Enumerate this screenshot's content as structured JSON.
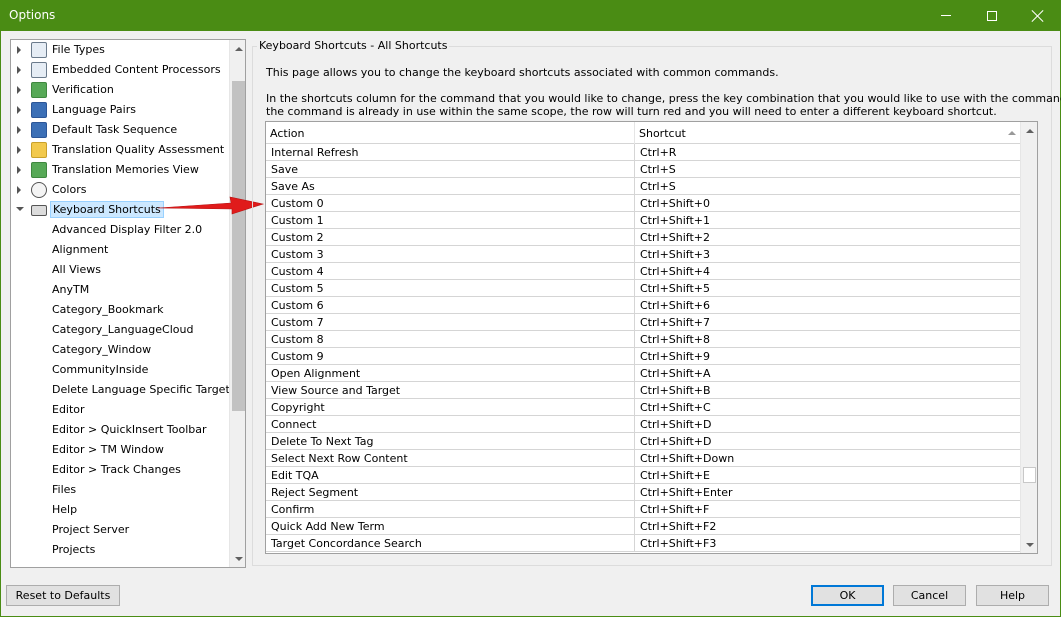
{
  "window": {
    "title": "Options"
  },
  "tree": {
    "top_items": [
      {
        "label": "File Types",
        "icon": "file-types-icon"
      },
      {
        "label": "Embedded Content Processors",
        "icon": "embedded-content-icon"
      },
      {
        "label": "Verification",
        "icon": "verification-icon"
      },
      {
        "label": "Language Pairs",
        "icon": "language-pairs-icon"
      },
      {
        "label": "Default Task Sequence",
        "icon": "task-sequence-icon"
      },
      {
        "label": "Translation Quality Assessment",
        "icon": "tqa-icon"
      },
      {
        "label": "Translation Memories View",
        "icon": "tm-view-icon"
      },
      {
        "label": "Colors",
        "icon": "palette-icon"
      },
      {
        "label": "Keyboard Shortcuts",
        "icon": "keyboard-icon"
      }
    ],
    "children": [
      "Advanced Display Filter 2.0",
      "Alignment",
      "All Views",
      "AnyTM",
      "Category_Bookmark",
      "Category_LanguageCloud",
      "Category_Window",
      "CommunityInside",
      "Delete Language Specific Target Fil",
      "Editor",
      "Editor > QuickInsert Toolbar",
      "Editor > TM Window",
      "Editor > Track Changes",
      "Files",
      "Help",
      "Project Server",
      "Projects"
    ]
  },
  "panel": {
    "title": "Keyboard Shortcuts - All Shortcuts",
    "desc1": "This page allows you to change the keyboard shortcuts associated with common commands.",
    "desc2": "In the shortcuts column for the command that you would like to change, press the key combination that you would like to use with the command.  If",
    "desc3": "the command is already in use within the same scope, the row will turn red and you will need to enter a different keyboard shortcut."
  },
  "grid": {
    "columns": [
      "Action",
      "Shortcut"
    ],
    "rows": [
      [
        "Internal Refresh",
        "Ctrl+R"
      ],
      [
        "Save",
        "Ctrl+S"
      ],
      [
        "Save As",
        "Ctrl+S"
      ],
      [
        "Custom 0",
        "Ctrl+Shift+0"
      ],
      [
        "Custom 1",
        "Ctrl+Shift+1"
      ],
      [
        "Custom 2",
        "Ctrl+Shift+2"
      ],
      [
        "Custom 3",
        "Ctrl+Shift+3"
      ],
      [
        "Custom 4",
        "Ctrl+Shift+4"
      ],
      [
        "Custom 5",
        "Ctrl+Shift+5"
      ],
      [
        "Custom 6",
        "Ctrl+Shift+6"
      ],
      [
        "Custom 7",
        "Ctrl+Shift+7"
      ],
      [
        "Custom 8",
        "Ctrl+Shift+8"
      ],
      [
        "Custom 9",
        "Ctrl+Shift+9"
      ],
      [
        "Open Alignment",
        "Ctrl+Shift+A"
      ],
      [
        "View Source and Target",
        "Ctrl+Shift+B"
      ],
      [
        "Copyright",
        "Ctrl+Shift+C"
      ],
      [
        "Connect",
        "Ctrl+Shift+D"
      ],
      [
        "Delete To Next Tag",
        "Ctrl+Shift+D"
      ],
      [
        "Select Next Row Content",
        "Ctrl+Shift+Down"
      ],
      [
        "Edit TQA",
        "Ctrl+Shift+E"
      ],
      [
        "Reject Segment",
        "Ctrl+Shift+Enter"
      ],
      [
        "Confirm",
        "Ctrl+Shift+F"
      ],
      [
        "Quick Add New Term",
        "Ctrl+Shift+F2"
      ],
      [
        "Target Concordance Search",
        "Ctrl+Shift+F3"
      ]
    ]
  },
  "buttons": {
    "reset": "Reset to Defaults",
    "ok": "OK",
    "cancel": "Cancel",
    "help": "Help"
  },
  "colors": {
    "titlebar": "#4a8c14",
    "selection": "#cce8ff",
    "arrow": "#e01b1b"
  }
}
